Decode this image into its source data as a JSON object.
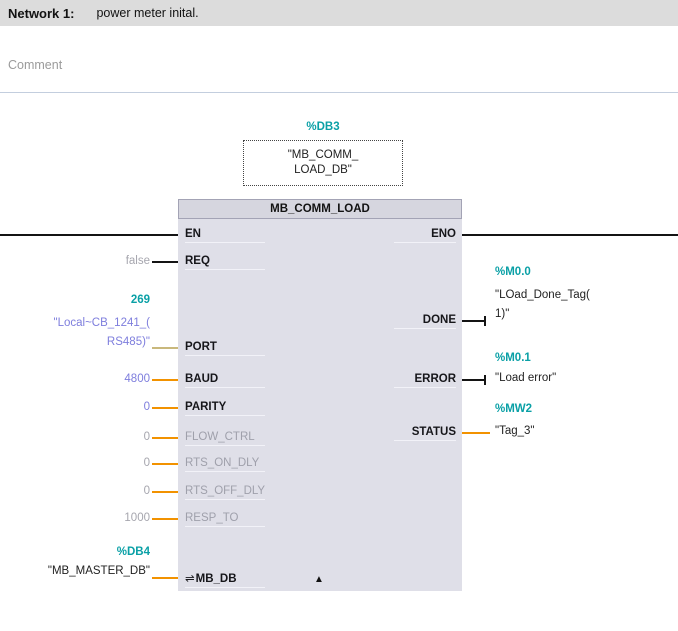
{
  "colors": {
    "address_teal": "#0aa0a6",
    "operand_blue": "#7e7edd",
    "dim_gray": "#9fa0ab",
    "wire_orange": "#f29200",
    "wire_tan": "#c9b87c",
    "wire_black": "#141414",
    "block_body": "#dfdfe8",
    "block_header": "#d6d6df",
    "network_bar": "#dcdcdc"
  },
  "network": {
    "label": "Network 1:",
    "title": "power meter inital.",
    "comment": "Comment"
  },
  "instance_db": {
    "address": "%DB3",
    "name_line1": "\"MB_COMM_",
    "name_line2": "LOAD_DB\""
  },
  "block": {
    "title": "MB_COMM_LOAD",
    "collapse_icon": "▲",
    "inout_icon": "⇌"
  },
  "pins": {
    "en": {
      "label": "EN"
    },
    "req": {
      "label": "REQ",
      "value": "false"
    },
    "port": {
      "label": "PORT",
      "value": "269",
      "operand_line1": "\"Local~CB_1241_(",
      "operand_line2": "RS485)\""
    },
    "baud": {
      "label": "BAUD",
      "value": "4800"
    },
    "parity": {
      "label": "PARITY",
      "value": "0"
    },
    "flow_ctrl": {
      "label": "FLOW_CTRL",
      "value": "0"
    },
    "rts_on_dly": {
      "label": "RTS_ON_DLY",
      "value": "0"
    },
    "rts_off_dly": {
      "label": "RTS_OFF_DLY",
      "value": "0"
    },
    "resp_to": {
      "label": "RESP_TO",
      "value": "1000"
    },
    "mb_db": {
      "label": "MB_DB",
      "address": "%DB4",
      "operand": "\"MB_MASTER_DB\""
    },
    "eno": {
      "label": "ENO"
    },
    "done": {
      "label": "DONE",
      "address": "%M0.0",
      "operand_line1": "\"LOad_Done_Tag(",
      "operand_line2": "1)\""
    },
    "error": {
      "label": "ERROR",
      "address": "%M0.1",
      "operand": "\"Load error\""
    },
    "status": {
      "label": "STATUS",
      "address": "%MW2",
      "operand": "\"Tag_3\""
    }
  }
}
